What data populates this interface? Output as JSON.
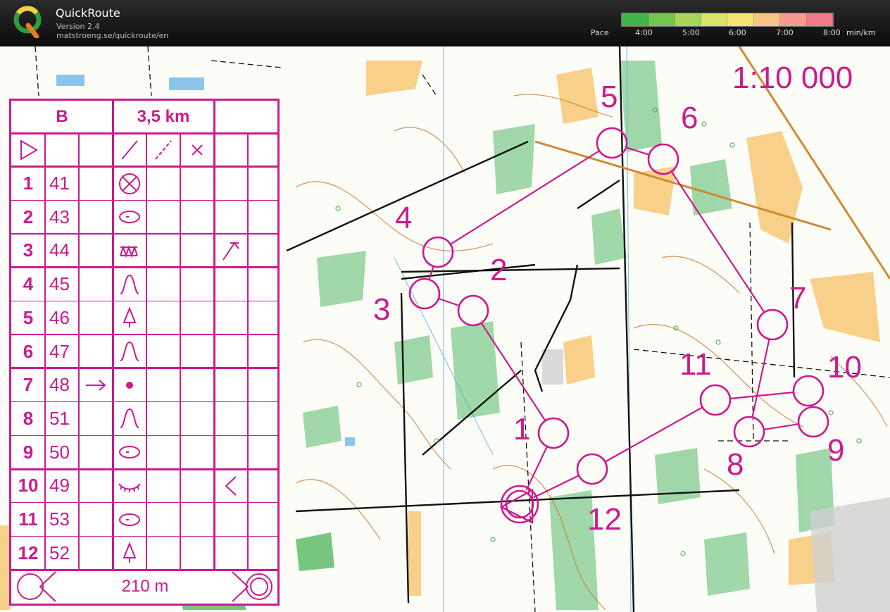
{
  "app": {
    "title": "QuickRoute",
    "version": "Version 2.4",
    "url": "matstroeng.se/quickroute/en"
  },
  "pace_legend": {
    "label": "Pace",
    "ticks": [
      "4:00",
      "5:00",
      "6:00",
      "7:00",
      "8:00"
    ],
    "unit": "min/km",
    "colors": [
      "#3fb449",
      "#73c54c",
      "#a8d45b",
      "#d8e36a",
      "#f2e574",
      "#f7c483",
      "#f49a8e",
      "#ef7a8a"
    ]
  },
  "map": {
    "scale": "1:10 000",
    "course_color": "#cc1a8f",
    "controls": [
      {
        "label": "1"
      },
      {
        "label": "2"
      },
      {
        "label": "3"
      },
      {
        "label": "4"
      },
      {
        "label": "5"
      },
      {
        "label": "6"
      },
      {
        "label": "7"
      },
      {
        "label": "8"
      },
      {
        "label": "9"
      },
      {
        "label": "10"
      },
      {
        "label": "11"
      },
      {
        "label": "12"
      }
    ]
  },
  "description_sheet": {
    "course": "B",
    "length": "3,5 km",
    "start_symbol": "start-triangle-icon",
    "crossing_symbols": [
      "straight-line-icon",
      "dashed-line-icon",
      "cross-icon"
    ],
    "rows": [
      {
        "num": "1",
        "code": "41",
        "dir": "",
        "feature": "cross-circle-icon",
        "extra": ""
      },
      {
        "num": "2",
        "code": "43",
        "dir": "",
        "feature": "ellipse-icon",
        "extra": ""
      },
      {
        "num": "3",
        "code": "44",
        "dir": "",
        "feature": "zigzag-box-icon",
        "extra": "corner-icon"
      },
      {
        "num": "4",
        "code": "45",
        "dir": "",
        "feature": "knoll-icon",
        "extra": ""
      },
      {
        "num": "5",
        "code": "46",
        "dir": "",
        "feature": "tree-icon",
        "extra": ""
      },
      {
        "num": "6",
        "code": "47",
        "dir": "",
        "feature": "knoll-icon",
        "extra": ""
      },
      {
        "num": "7",
        "code": "48",
        "dir": "arrow-right-icon",
        "feature": "dot-icon",
        "extra": ""
      },
      {
        "num": "8",
        "code": "51",
        "dir": "",
        "feature": "knoll-icon",
        "extra": ""
      },
      {
        "num": "9",
        "code": "50",
        "dir": "",
        "feature": "ellipse-icon",
        "extra": ""
      },
      {
        "num": "10",
        "code": "49",
        "dir": "",
        "feature": "eyelash-icon",
        "extra": "angle-left-icon"
      },
      {
        "num": "11",
        "code": "53",
        "dir": "",
        "feature": "ellipse-icon",
        "extra": ""
      },
      {
        "num": "12",
        "code": "52",
        "dir": "",
        "feature": "tree-icon",
        "extra": ""
      }
    ],
    "finish_distance": "210 m"
  }
}
